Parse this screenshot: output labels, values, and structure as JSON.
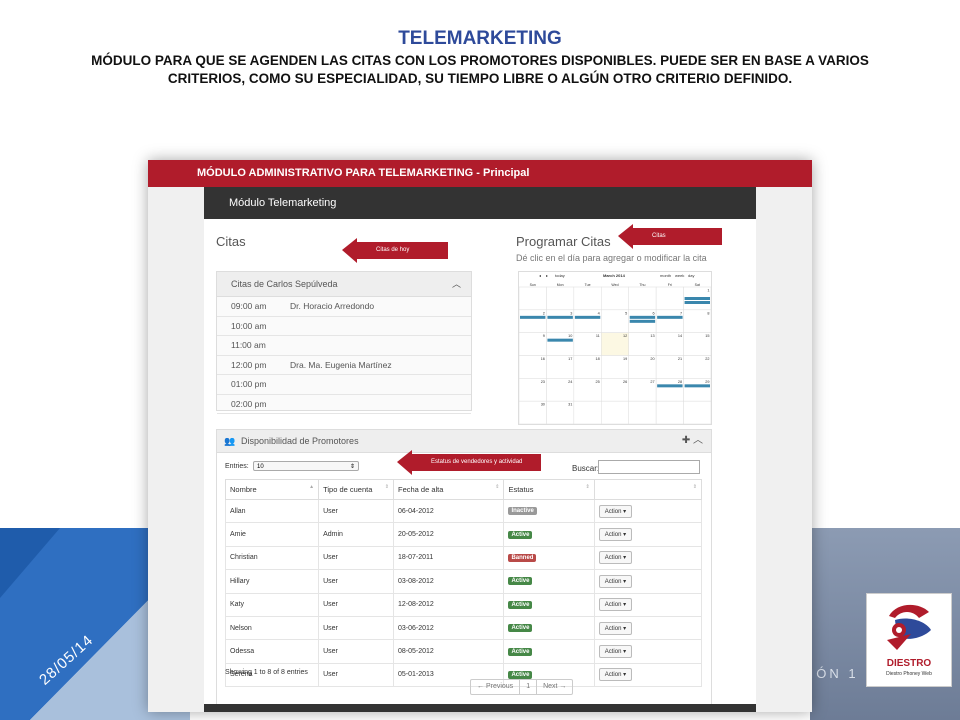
{
  "slide": {
    "title": "TELEMARKETING",
    "subtitle_line1": "MÓDULO PARA QUE SE AGENDEN LAS CITAS CON LOS PROMOTORES DISPONIBLES. PUEDE SER EN BASE A VARIOS",
    "subtitle_line2": "CRITERIOS, COMO SU ESPECIALIDAD, SU TIEMPO LIBRE O ALGÚN OTRO CRITERIO DEFINIDO.",
    "date": "28/05/14",
    "version": "SIÓN 1",
    "logo_text": "DIESTRO",
    "logo_subtext": "Diestro Phoney Web",
    "colors": {
      "title": "#2e4a9a",
      "accent": "#b01c2b",
      "nav": "#333333"
    }
  },
  "app": {
    "header": "MÓDULO ADMINISTRATIVO PARA TELEMARKETING - Principal",
    "nav_title": "Módulo Telemarketing",
    "citas_title": "Citas",
    "programar_title": "Programar Citas",
    "programar_sub": "Dé clic en el día para agregar o modificar la cita",
    "callouts": {
      "citas_hoy": "Citas de hoy",
      "citas": "Citas",
      "estatus": "Estatus de vendedores y actividad"
    },
    "citas_box": {
      "title": "Citas de Carlos Sepúlveda",
      "rows": [
        {
          "time": "09:00 am",
          "doctor": "Dr. Horacio Arredondo"
        },
        {
          "time": "10:00 am",
          "doctor": ""
        },
        {
          "time": "11:00 am",
          "doctor": ""
        },
        {
          "time": "12:00 pm",
          "doctor": "Dra. Ma. Eugenia Martínez"
        },
        {
          "time": "01:00 pm",
          "doctor": ""
        },
        {
          "time": "02:00 pm",
          "doctor": ""
        }
      ]
    },
    "calendar": {
      "month": "March 2014",
      "today": "today",
      "views": [
        "month",
        "week",
        "day"
      ],
      "weekdays": [
        "Sun",
        "Mon",
        "Tue",
        "Wed",
        "Thu",
        "Fri",
        "Sat"
      ],
      "weeks": [
        [
          "",
          "",
          "",
          "",
          "",
          "",
          "1"
        ],
        [
          "2",
          "3",
          "4",
          "5",
          "6",
          "7",
          "8"
        ],
        [
          "9",
          "10",
          "11",
          "12",
          "13",
          "14",
          "15"
        ],
        [
          "16",
          "17",
          "18",
          "19",
          "20",
          "21",
          "22"
        ],
        [
          "23",
          "24",
          "25",
          "26",
          "27",
          "28",
          "29"
        ],
        [
          "30",
          "31",
          "",
          "",
          "",
          "",
          ""
        ]
      ],
      "event_color": "#3a87ad",
      "highlight_color": "#fcf8e3"
    },
    "disponibilidad": {
      "title": "Disponibilidad de Promotores",
      "entries_label": "Entries:",
      "entries_value": "10",
      "search_label": "Buscar:",
      "columns": [
        "Nombre",
        "Tipo de cuenta",
        "Fecha de alta",
        "Estatus",
        ""
      ],
      "rows": [
        {
          "name": "Allan",
          "type": "User",
          "date": "06-04-2012",
          "status": "Inactive",
          "status_color": "#999999",
          "action": "Action"
        },
        {
          "name": "Amie",
          "type": "Admin",
          "date": "20-05-2012",
          "status": "Active",
          "status_color": "#468847",
          "action": "Action"
        },
        {
          "name": "Christian",
          "type": "User",
          "date": "18-07-2011",
          "status": "Banned",
          "status_color": "#b94a48",
          "action": "Action"
        },
        {
          "name": "Hillary",
          "type": "User",
          "date": "03-08-2012",
          "status": "Active",
          "status_color": "#468847",
          "action": "Action"
        },
        {
          "name": "Katy",
          "type": "User",
          "date": "12-08-2012",
          "status": "Active",
          "status_color": "#468847",
          "action": "Action"
        },
        {
          "name": "Nelson",
          "type": "User",
          "date": "03-06-2012",
          "status": "Active",
          "status_color": "#468847",
          "action": "Action"
        },
        {
          "name": "Odessa",
          "type": "User",
          "date": "08-05-2012",
          "status": "Active",
          "status_color": "#468847",
          "action": "Action"
        },
        {
          "name": "Serena",
          "type": "User",
          "date": "05-01-2013",
          "status": "Active",
          "status_color": "#468847",
          "action": "Action"
        }
      ],
      "showing": "Showing 1 to 8 of 8 entries",
      "pager": {
        "prev": "← Previous",
        "page": "1",
        "next": "Next →"
      }
    }
  }
}
